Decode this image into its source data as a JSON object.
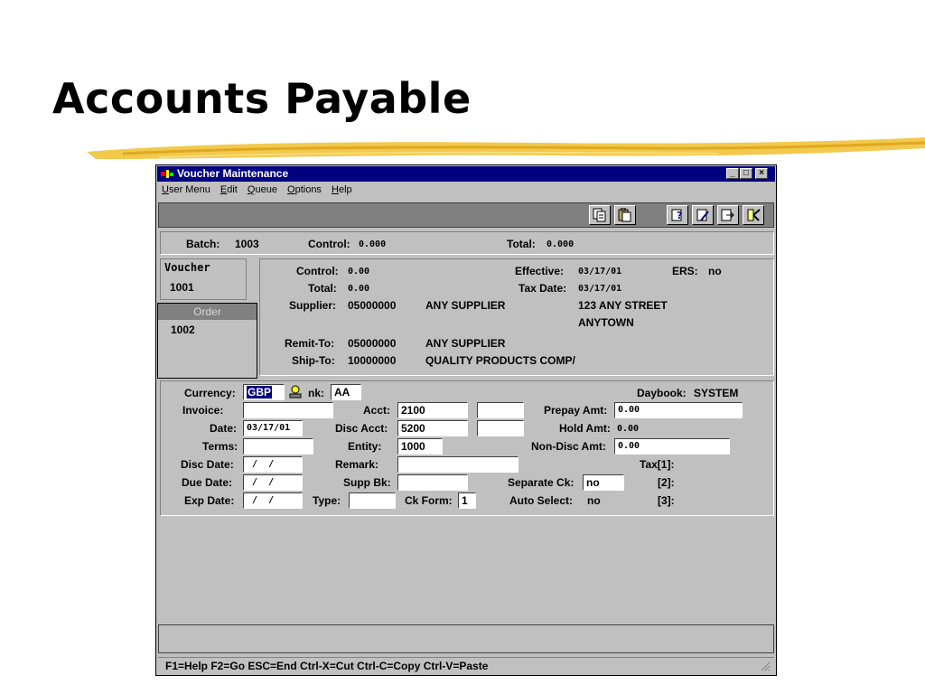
{
  "slide": {
    "title": "Accounts Payable"
  },
  "window": {
    "title": "Voucher Maintenance",
    "controls": {
      "minimize": "_",
      "maximize": "□",
      "close": "×"
    }
  },
  "menu": [
    {
      "label": "User Menu",
      "key": "U",
      "rest": "ser Menu"
    },
    {
      "label": "Edit",
      "key": "E",
      "rest": "dit"
    },
    {
      "label": "Queue",
      "key": "Q",
      "rest": "ueue"
    },
    {
      "label": "Options",
      "key": "O",
      "rest": "ptions"
    },
    {
      "label": "Help",
      "key": "H",
      "rest": "elp"
    }
  ],
  "toolbar_icons": [
    "copy-icon",
    "paste-icon",
    "help-query-icon",
    "edit-query-icon",
    "export-icon",
    "exit-icon"
  ],
  "header": {
    "batch_label": "Batch:",
    "batch": "1003",
    "control_label": "Control:",
    "control": "0.000",
    "total_label": "Total:",
    "total": "0.000"
  },
  "voucher": {
    "group_label": "Voucher",
    "voucher_no": "1001",
    "order_label": "Order",
    "order_no": "1002",
    "control_label": "Control:",
    "control": "0.00",
    "total_label": "Total:",
    "total": "0.00",
    "effective_label": "Effective:",
    "effective": "03/17/01",
    "ers_label": "ERS:",
    "ers": "no",
    "taxdate_label": "Tax Date:",
    "taxdate": "03/17/01",
    "supplier_label": "Supplier:",
    "supplier_code": "05000000",
    "supplier_name": "ANY SUPPLIER",
    "addr1": "123 ANY STREET",
    "addr2": "ANYTOWN",
    "remit_label": "Remit-To:",
    "remit_code": "05000000",
    "remit_name": "ANY SUPPLIER",
    "ship_label": "Ship-To:",
    "ship_code": "10000000",
    "ship_name": "QUALITY PRODUCTS COMP/"
  },
  "detail": {
    "currency_label": "Currency:",
    "currency": "GBP",
    "bank_label": "nk:",
    "bank": "AA",
    "daybook_label": "Daybook:",
    "daybook": "SYSTEM",
    "invoice_label": "Invoice:",
    "invoice": "",
    "acct_label": "Acct:",
    "acct": "2100",
    "acct_sub": "",
    "prepay_label": "Prepay Amt:",
    "prepay": "0.00",
    "date_label": "Date:",
    "date": "03/17/01",
    "discacct_label": "Disc Acct:",
    "discacct": "5200",
    "discacct_sub": "",
    "hold_label": "Hold Amt:",
    "hold": "0.00",
    "terms_label": "Terms:",
    "terms": "",
    "entity_label": "Entity:",
    "entity": "1000",
    "nondisc_label": "Non-Disc Amt:",
    "nondisc": "0.00",
    "discdate_label": "Disc Date:",
    "discdate": " /  /",
    "remark_label": "Remark:",
    "remark": "",
    "tax1_label": "Tax[1]:",
    "duedate_label": "Due Date:",
    "duedate": " /  /",
    "suppbk_label": "Supp Bk:",
    "suppbk": "",
    "sepck_label": "Separate Ck:",
    "sepck": "no",
    "tax2_label": "[2]:",
    "expdate_label": "Exp Date:",
    "expdate": " /  /",
    "type_label": "Type:",
    "type": "",
    "ckform_label": "Ck Form:",
    "ckform": "1",
    "autosel_label": "Auto Select:",
    "autosel": "no",
    "tax3_label": "[3]:"
  },
  "status": {
    "hints": "F1=Help  F2=Go  ESC=End  Ctrl-X=Cut  Ctrl-C=Copy  Ctrl-V=Paste"
  },
  "colors": {
    "title_bar": "#000080",
    "face": "#c0c0c0",
    "brush": "#f2c94c"
  }
}
